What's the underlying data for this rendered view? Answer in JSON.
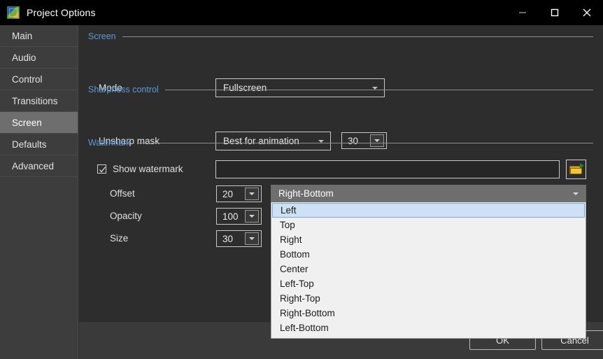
{
  "window": {
    "title": "Project Options",
    "icon": "image-options-icon",
    "controls": {
      "minimize": "minimize-icon",
      "maximize": "maximize-icon",
      "close": "close-icon"
    }
  },
  "sidebar": {
    "items": [
      {
        "label": "Main",
        "selected": false
      },
      {
        "label": "Audio",
        "selected": false
      },
      {
        "label": "Control",
        "selected": false
      },
      {
        "label": "Transitions",
        "selected": false
      },
      {
        "label": "Screen",
        "selected": true
      },
      {
        "label": "Defaults",
        "selected": false
      },
      {
        "label": "Advanced",
        "selected": false
      }
    ]
  },
  "sections": {
    "screen": {
      "title": "Screen",
      "mode_label": "Mode",
      "mode_value": "Fullscreen"
    },
    "sharpness": {
      "title": "Sharpness control",
      "unsharp_label": "Unsharp mask",
      "unsharp_value": "Best for animation",
      "unsharp_amount": "30"
    },
    "watermark": {
      "title": "Watermark",
      "show_label": "Show watermark",
      "show_checked": true,
      "path_value": "",
      "browse_icon": "open-folder-icon",
      "offset_label": "Offset",
      "offset_value": "20",
      "opacity_label": "Opacity",
      "opacity_value": "100",
      "size_label": "Size",
      "size_value": "30"
    }
  },
  "position_dropdown": {
    "selected": "Right-Bottom",
    "highlighted": "Left",
    "options": [
      "Left",
      "Top",
      "Right",
      "Bottom",
      "Center",
      "Left-Top",
      "Right-Top",
      "Right-Bottom",
      "Left-Bottom"
    ]
  },
  "footer": {
    "ok_label": "OK",
    "cancel_label": "Cancel"
  },
  "colors": {
    "accent_blue": "#5e9ad6",
    "window_bg": "#2d2d2d",
    "sidebar_bg": "#3d3d3d",
    "selected_item": "#6e6e6e",
    "dropdown_bg": "#f0f0f0",
    "highlight": "#cde0f5"
  }
}
